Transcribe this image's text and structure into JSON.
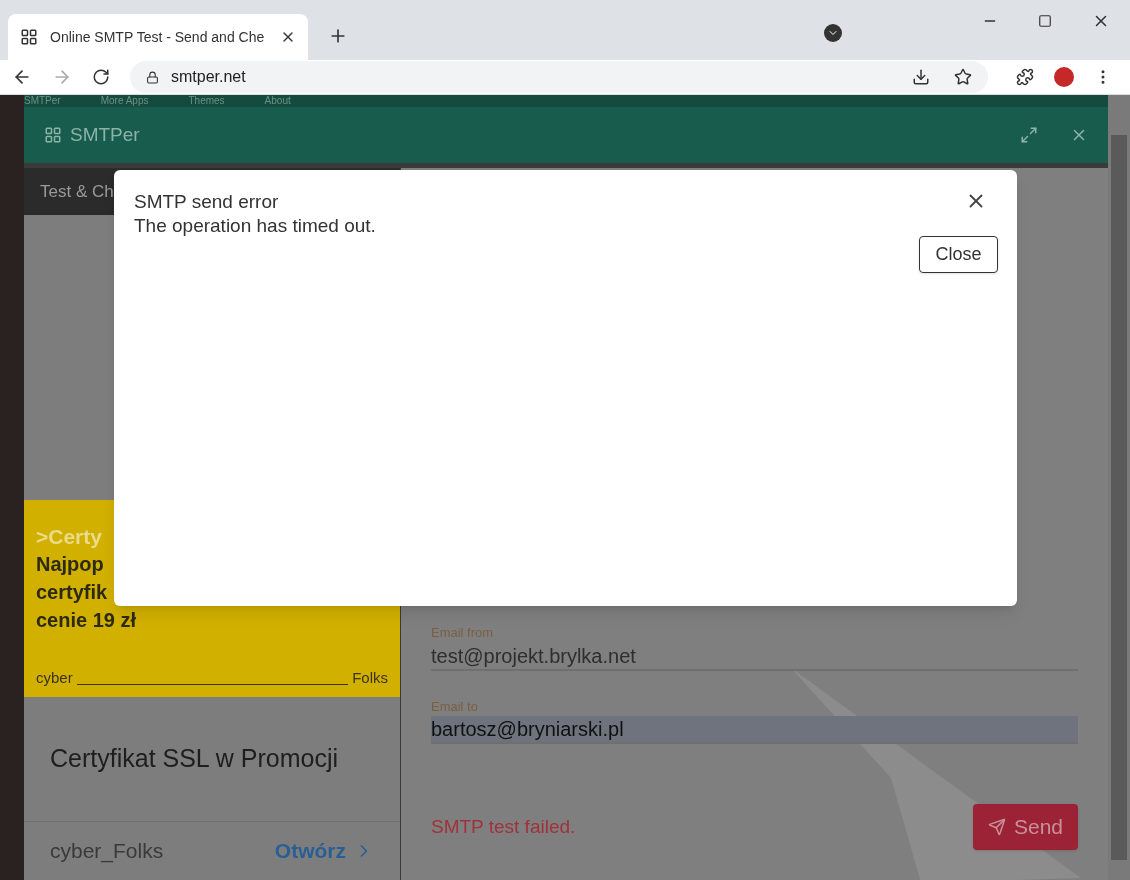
{
  "browser": {
    "tab_title": "Online SMTP Test - Send and Che",
    "url": "smtper.net"
  },
  "nav": {
    "items": [
      {
        "label": "SMTPer"
      },
      {
        "label": "More Apps"
      },
      {
        "label": "Themes"
      },
      {
        "label": "About"
      }
    ]
  },
  "app": {
    "title": "SMTPer",
    "sidebar_tab": "Test & Ch",
    "ad": {
      "lines": [
        ">Certy",
        "Najpop",
        "certyfik",
        "cenie 19 zł"
      ],
      "brand_left": "cyber",
      "brand_right": "Folks",
      "title": "Certyfikat SSL w Promocji",
      "advertiser": "cyber_Folks",
      "link": "Otwórz"
    },
    "form": {
      "fields": [
        {
          "label": "Email from",
          "value": "test@projekt.brylka.net",
          "highlighted": false
        },
        {
          "label": "Email to",
          "value": "bartosz@bryniarski.pl",
          "highlighted": true
        }
      ],
      "status": "SMTP test failed.",
      "send_button": "Send"
    }
  },
  "dialog": {
    "title": "SMTP send error",
    "message": "The operation has timed out.",
    "close_button": "Close"
  }
}
